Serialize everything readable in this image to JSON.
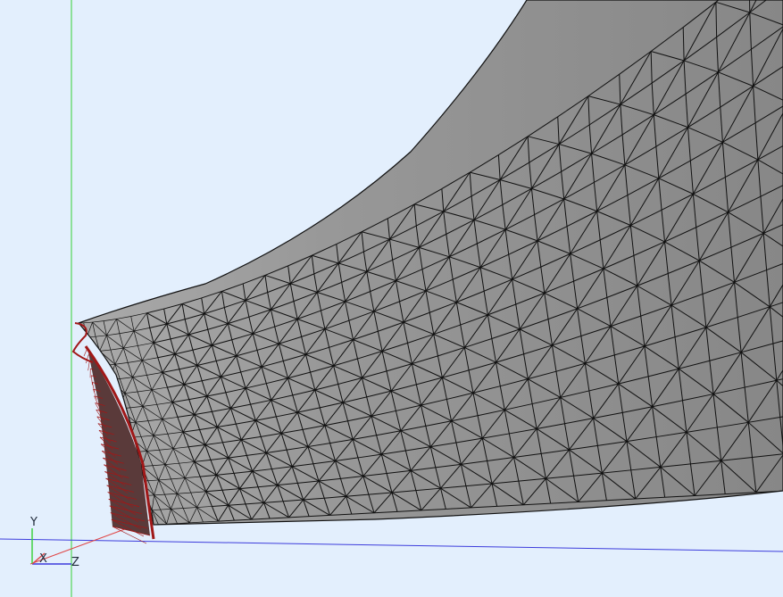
{
  "viewport": {
    "background": "#e3effd",
    "mesh_fill": "#8b8b8b",
    "mesh_stroke": "#111111",
    "edge_feature_color": "#a01818",
    "axis_colors": {
      "x": "#e04545",
      "y": "#35d035",
      "z": "#3c3cdc"
    }
  },
  "triad": {
    "y_label": "Y",
    "x_label": "X",
    "z_label": "Z"
  }
}
